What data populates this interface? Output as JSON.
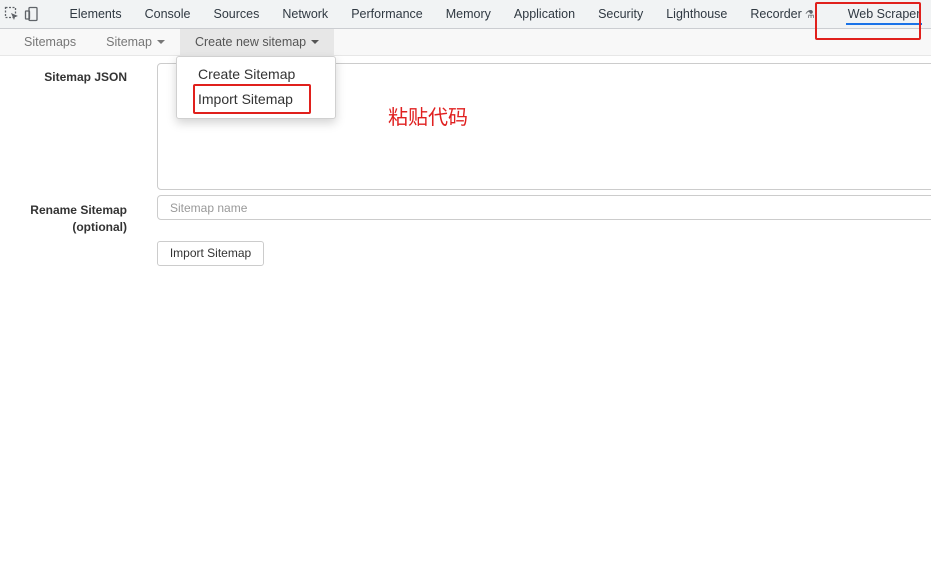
{
  "devtools": {
    "tabs": [
      {
        "label": "Elements"
      },
      {
        "label": "Console"
      },
      {
        "label": "Sources"
      },
      {
        "label": "Network"
      },
      {
        "label": "Performance"
      },
      {
        "label": "Memory"
      },
      {
        "label": "Application"
      },
      {
        "label": "Security"
      },
      {
        "label": "Lighthouse"
      },
      {
        "label": "Recorder"
      }
    ],
    "active_tab": "Web Scraper",
    "recorder_badge_icon": "flask-icon"
  },
  "nav": {
    "items": [
      {
        "label": "Sitemaps"
      },
      {
        "label": "Sitemap"
      },
      {
        "label": "Create new sitemap"
      }
    ]
  },
  "dropdown": {
    "items": [
      {
        "label": "Create Sitemap"
      },
      {
        "label": "Import Sitemap"
      }
    ]
  },
  "form": {
    "json_label": "Sitemap JSON",
    "json_value": "",
    "rename_label_line1": "Rename Sitemap",
    "rename_label_line2": "(optional)",
    "name_placeholder": "Sitemap name",
    "name_value": "",
    "submit_label": "Import Sitemap"
  },
  "annotation": {
    "text": "粘贴代码"
  },
  "colors": {
    "annotation_red": "#e0201c",
    "active_tab_underline": "#1a73e8"
  }
}
